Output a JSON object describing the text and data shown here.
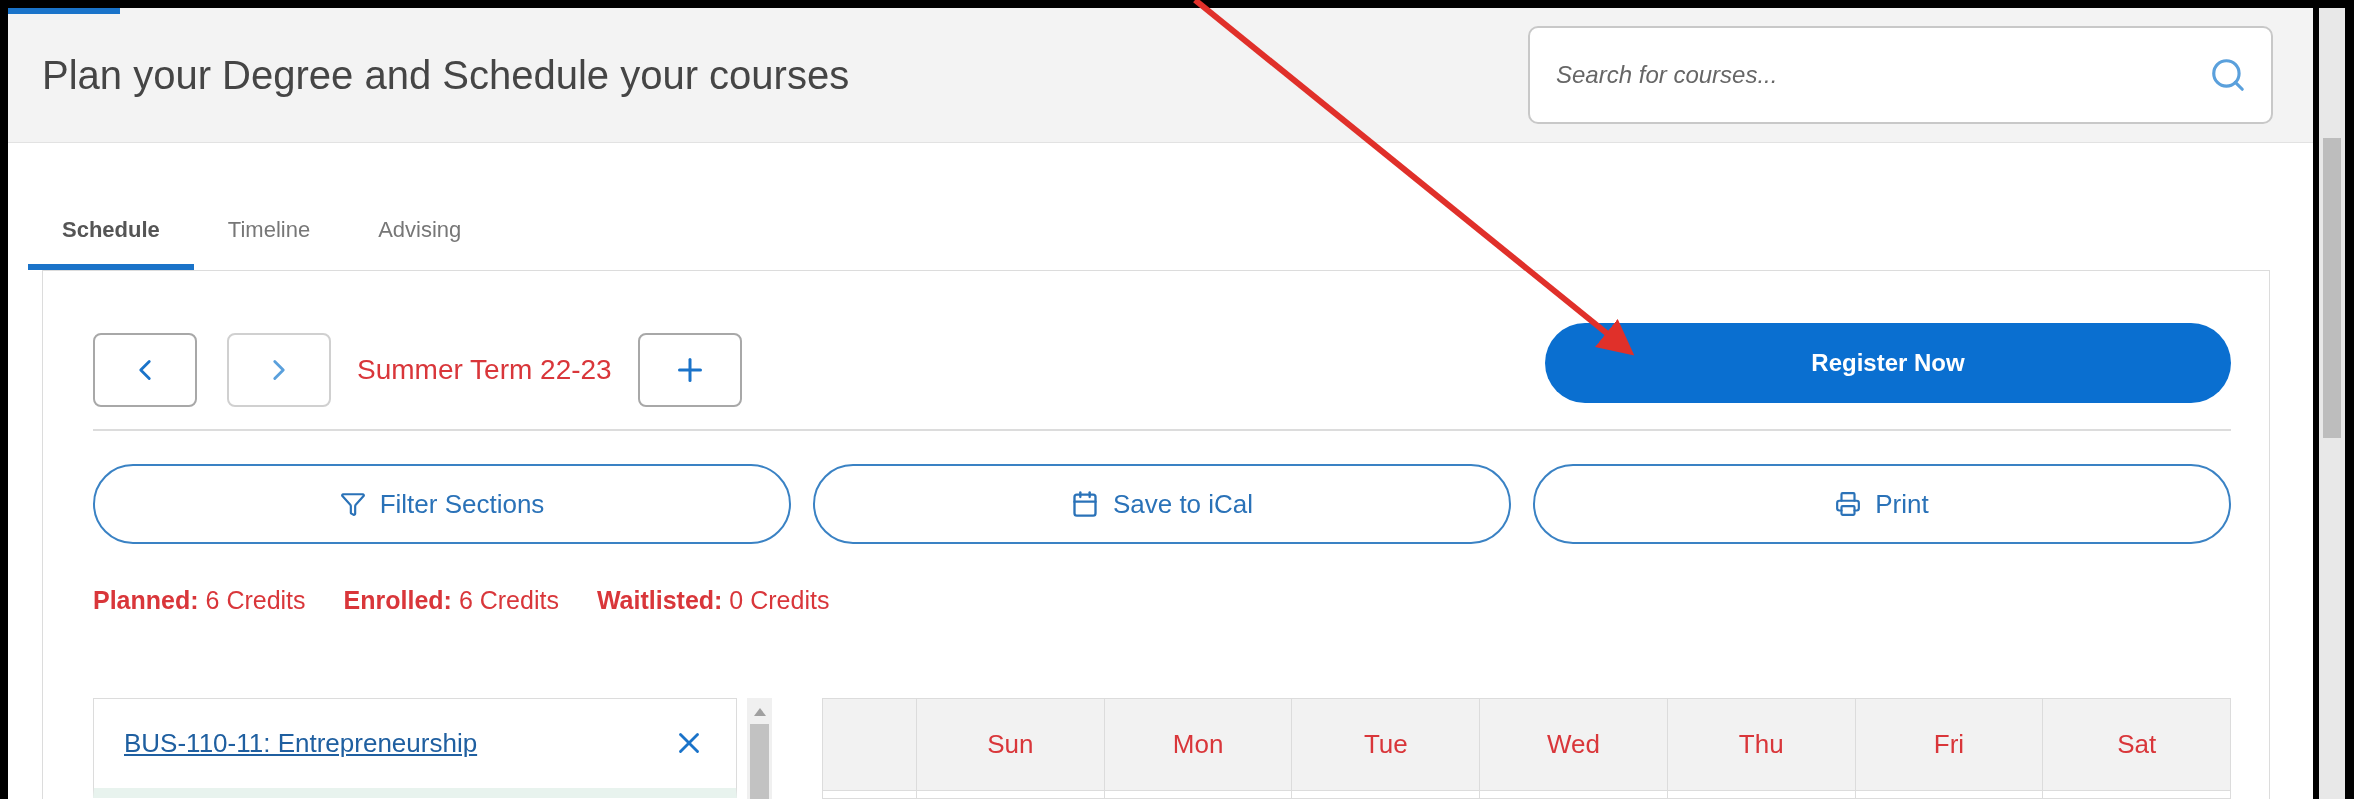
{
  "page": {
    "title": "Plan your Degree and Schedule your courses",
    "search": {
      "placeholder": "Search for courses..."
    }
  },
  "tabs": [
    {
      "label": "Schedule",
      "selected": true
    },
    {
      "label": "Timeline",
      "selected": false
    },
    {
      "label": "Advising",
      "selected": false
    }
  ],
  "term": {
    "label": "Summer Term 22-23"
  },
  "register_button": "Register Now",
  "actions": [
    {
      "kind": "filter",
      "label": "Filter Sections"
    },
    {
      "kind": "calendar",
      "label": "Save to iCal"
    },
    {
      "kind": "print",
      "label": "Print"
    }
  ],
  "credits": [
    {
      "label": "Planned:",
      "value": "6 Credits"
    },
    {
      "label": "Enrolled:",
      "value": "6 Credits"
    },
    {
      "label": "Waitlisted:",
      "value": "0 Credits"
    }
  ],
  "courses": [
    {
      "title": "BUS-110-11: Entrepreneurship"
    }
  ],
  "calendar": {
    "days": [
      "Sun",
      "Mon",
      "Tue",
      "Wed",
      "Thu",
      "Fri",
      "Sat"
    ]
  }
}
